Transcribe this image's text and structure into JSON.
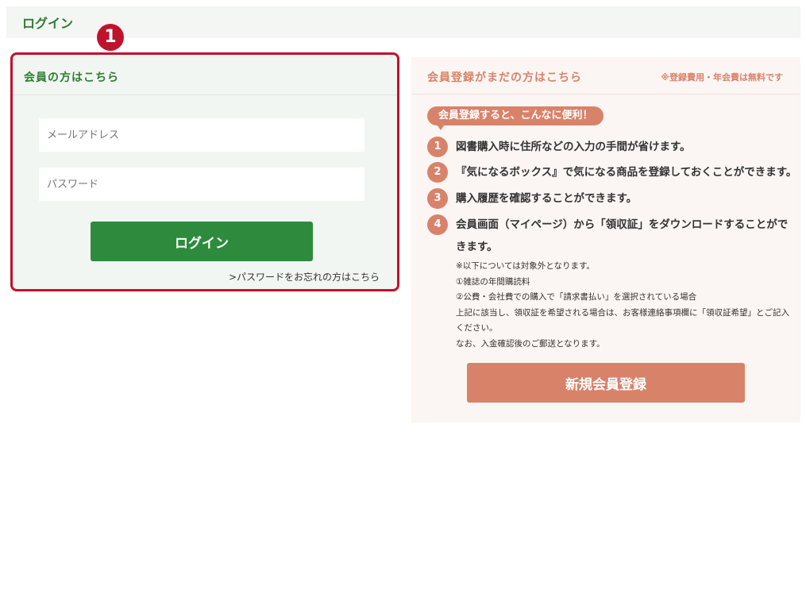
{
  "header": {
    "title": "ログイン"
  },
  "marker": {
    "label": "1"
  },
  "login": {
    "section_title": "会員の方はこちら",
    "email_placeholder": "メールアドレス",
    "password_placeholder": "パスワード",
    "login_button": "ログイン",
    "forgot_link": ">パスワードをお忘れの方はこちら"
  },
  "register": {
    "section_title": "会員登録がまだの方はこちら",
    "fee_note": "※登録費用・年会費は無料です",
    "benefit_heading": "会員登録すると、こんなに便利！",
    "benefits": [
      {
        "num": "1",
        "text": "図書購入時に住所などの入力の手間が省けます。"
      },
      {
        "num": "2",
        "text": "『気になるボックス』で気になる商品を登録しておくことができます。"
      },
      {
        "num": "3",
        "text": "購入履歴を確認することができます。"
      },
      {
        "num": "4",
        "text": "会員画面（マイページ）から「領収証」をダウンロードすることができます。"
      }
    ],
    "notes": [
      "※以下については対象外となります。",
      "①雑誌の年間購読料",
      "②公費・会社費での購入で「請求書払い」を選択されている場合",
      "上記に該当し、領収証を希望される場合は、お客様連絡事項欄に「領収証希望」とご記入ください。",
      "なお、入金確認後のご郵送となります。"
    ],
    "register_button": "新規会員登録"
  },
  "colors": {
    "login_accent": "#2e7d32",
    "login_button": "#2e8b3e",
    "register_accent": "#d9826a",
    "highlight_border": "#c0122d"
  }
}
